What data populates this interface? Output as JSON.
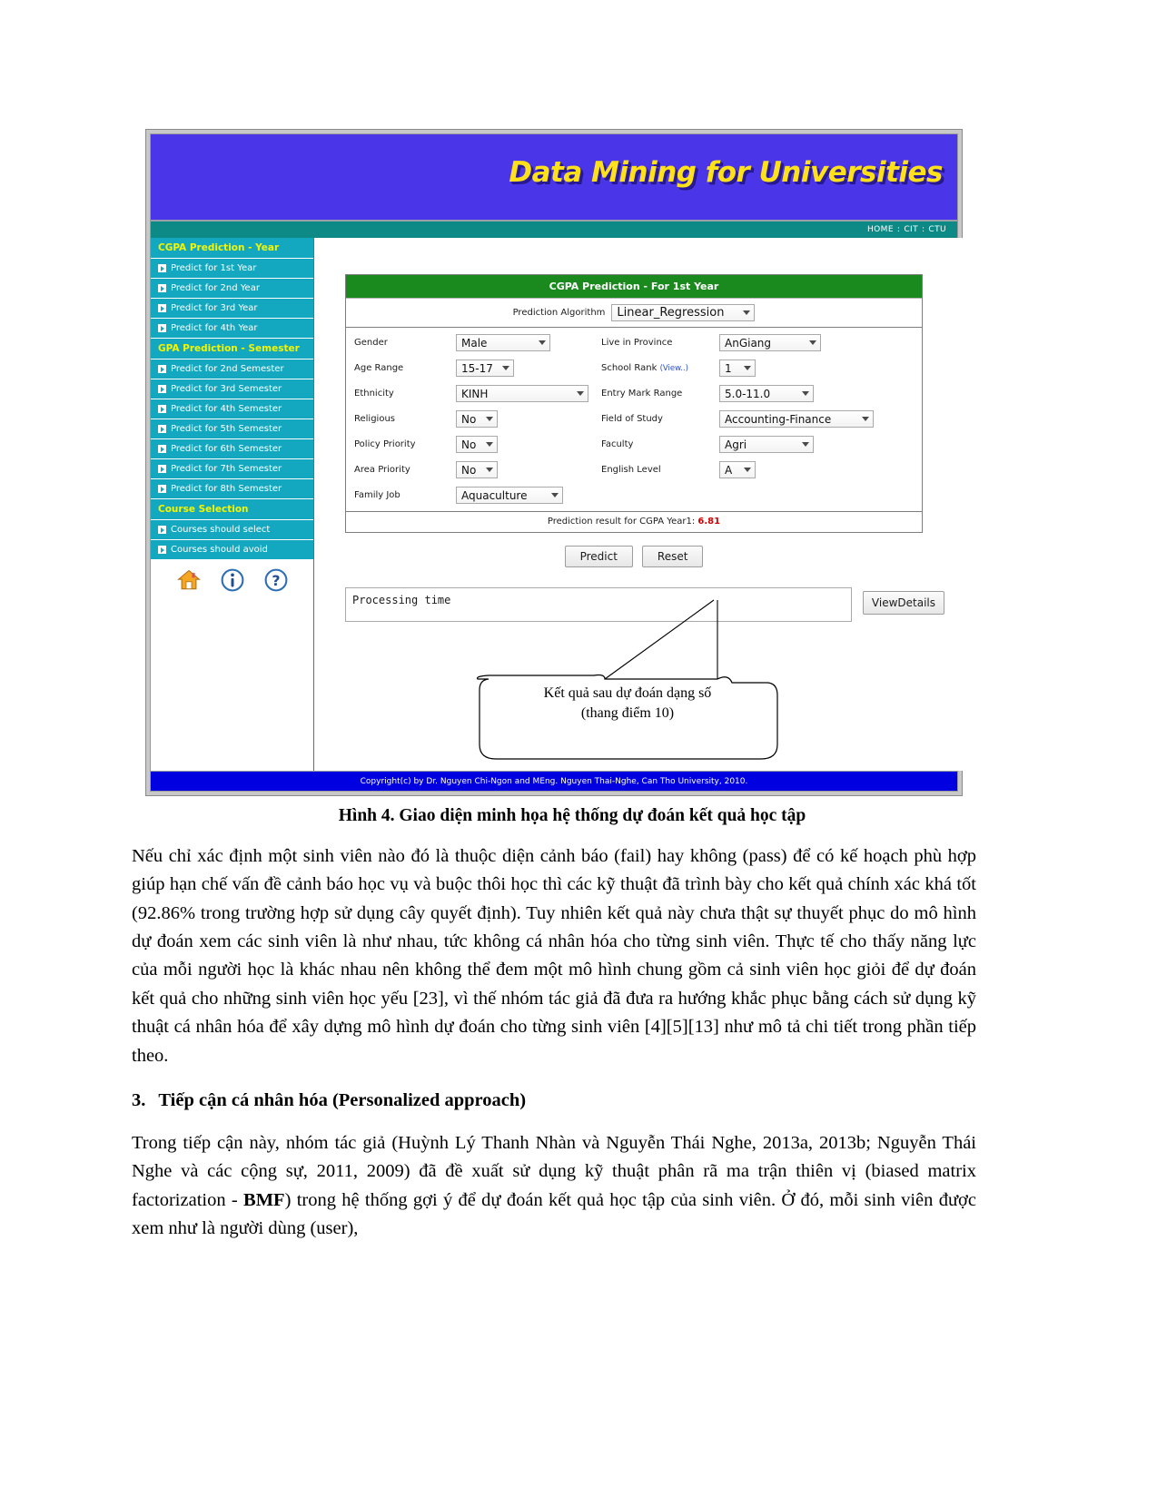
{
  "app": {
    "banner_title": "Data Mining for Universities",
    "nav": [
      "HOME",
      "CIT",
      "CTU"
    ],
    "nav_separator": ":",
    "colors": {
      "banner_bg": "#4b35e8",
      "banner_text": "#ffe11a",
      "nav_bg": "#0d8a86",
      "sidebar_bg": "#13a8bf",
      "sidebar_head_text": "#f5f500",
      "panel_title_bg": "#1a8a1f",
      "footer_bg": "#0000e0",
      "result_value": "#d00000",
      "link": "#2b4ec9"
    },
    "sidebar": {
      "groups": [
        {
          "title": "CGPA Prediction - Year",
          "items": [
            "Predict for 1st Year",
            "Predict for 2nd Year",
            "Predict for 3rd Year",
            "Predict for 4th Year"
          ]
        },
        {
          "title": "GPA Prediction - Semester",
          "items": [
            "Predict for 2nd Semester",
            "Predict for 3rd Semester",
            "Predict for 4th Semester",
            "Predict for 5th Semester",
            "Predict for 6th Semester",
            "Predict for 7th Semester",
            "Predict for 8th Semester"
          ]
        },
        {
          "title": "Course Selection",
          "items": [
            "Courses should select",
            "Courses should avoid"
          ]
        }
      ],
      "icons": [
        "home-icon",
        "info-icon",
        "help-icon"
      ]
    },
    "panel": {
      "title": "CGPA Prediction - For 1st Year",
      "algorithm_label": "Prediction Algorithm",
      "algorithm_value": "Linear_Regression",
      "left_fields": [
        {
          "label": "Gender",
          "value": "Male"
        },
        {
          "label": "Age Range",
          "value": "15-17"
        },
        {
          "label": "Ethnicity",
          "value": "KINH"
        },
        {
          "label": "Religious",
          "value": "No"
        },
        {
          "label": "Policy Priority",
          "value": "No"
        },
        {
          "label": "Area Priority",
          "value": "No"
        },
        {
          "label": "Family Job",
          "value": "Aquaculture"
        }
      ],
      "right_fields": [
        {
          "label": "Live in Province",
          "value": "AnGiang"
        },
        {
          "label": "School Rank",
          "link": "(View..)",
          "value": "1"
        },
        {
          "label": "Entry Mark Range",
          "value": "5.0-11.0"
        },
        {
          "label": "Field of Study",
          "value": "Accounting-Finance"
        },
        {
          "label": "Faculty",
          "value": "Agri"
        },
        {
          "label": "English Level",
          "value": "A"
        }
      ],
      "result_label": "Prediction result for CGPA Year1:",
      "result_value": "6.81"
    },
    "buttons": {
      "predict": "Predict",
      "reset": "Reset",
      "view_details": "ViewDetails"
    },
    "processing": {
      "text": "Processing time"
    },
    "footer": "Copyright(c) by Dr. Nguyen Chi-Ngon and MEng. Nguyen Thai-Nghe, Can Tho University, 2010.",
    "annotation": {
      "line1": "Kết quả sau dự đoán dạng số",
      "line2": "(thang điểm 10)"
    }
  },
  "document": {
    "caption": "Hình 4. Giao diện minh họa hệ thống dự đoán kết quả học tập",
    "paragraph1": "Nếu chỉ xác định một sinh viên nào đó là thuộc diện cảnh báo (fail) hay không (pass) để có kế hoạch phù hợp giúp hạn chế vấn đề cảnh báo học vụ và buộc thôi học thì các kỹ thuật đã trình bày cho kết quả chính xác khá tốt (92.86% trong trường hợp sử dụng cây quyết định). Tuy nhiên kết quả này chưa thật sự thuyết phục do mô hình dự đoán xem các sinh viên là như nhau, tức không cá nhân hóa cho từng sinh viên. Thực tế cho thấy năng lực của mỗi người học là khác nhau nên không thể đem một mô hình chung gồm cả sinh viên học giỏi để dự đoán kết quả cho những sinh viên học yếu [23], vì thế nhóm tác giả đã đưa ra hướng khắc phục bằng cách sử dụng kỹ thuật cá nhân hóa để xây dựng mô hình dự đoán cho từng sinh viên [4][5][13] như mô tả chi tiết trong phần tiếp theo.",
    "section_number": "3.",
    "section_title": "Tiếp cận cá nhân hóa (Personalized approach)",
    "paragraph2_part1": "Trong tiếp cận này, nhóm tác giả (Huỳnh Lý Thanh Nhàn và Nguyễn Thái Nghe, 2013a, 2013b; Nguyễn Thái Nghe và các cộng sự, 2011, 2009) đã đề xuất sử dụng kỹ thuật phân rã ma trận thiên vị (biased matrix factorization - ",
    "paragraph2_bold": "BMF",
    "paragraph2_part2": ") trong hệ thống gợi ý để dự đoán kết quả học tập của sinh viên. Ở đó, mỗi sinh viên được xem như là người dùng (user),"
  }
}
